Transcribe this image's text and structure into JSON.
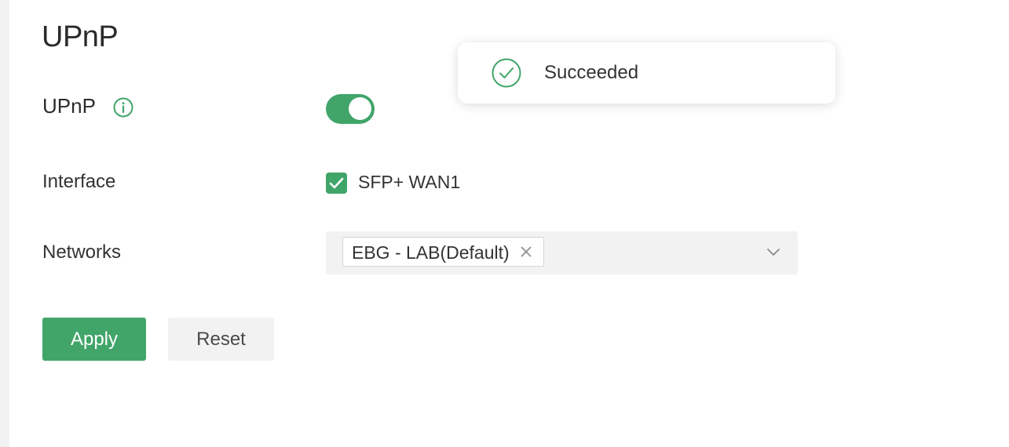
{
  "page": {
    "title": "UPnP"
  },
  "form": {
    "upnp": {
      "label": "UPnP",
      "enabled": true
    },
    "interface": {
      "label": "Interface",
      "option_label": "SFP+ WAN1",
      "checked": true
    },
    "networks": {
      "label": "Networks",
      "selected_tags": [
        "EBG - LAB(Default)"
      ]
    }
  },
  "actions": {
    "apply_label": "Apply",
    "reset_label": "Reset"
  },
  "toast": {
    "message": "Succeeded"
  },
  "colors": {
    "accent": "#41a56a",
    "neutral_bg": "#f2f2f2",
    "text": "#333333"
  },
  "icons": {
    "info": "info-icon",
    "success": "check-circle-icon",
    "checkmark": "checkmark-icon",
    "tag_remove": "close-icon",
    "dropdown": "chevron-down-icon"
  }
}
